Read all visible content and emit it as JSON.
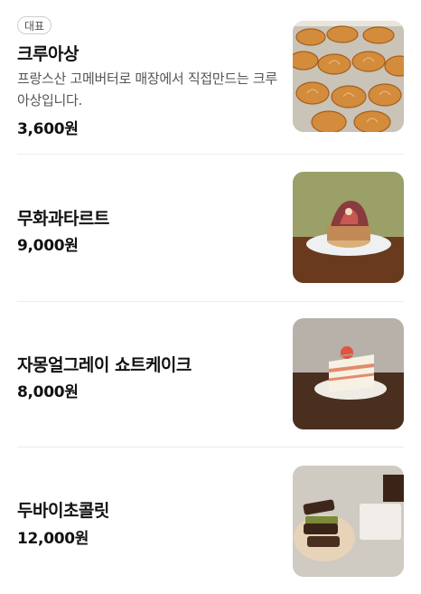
{
  "menu": {
    "items": [
      {
        "badge": "대표",
        "name": "크루아상",
        "description": "프랑스산 고메버터로 매장에서 직접만드는 크루아상입니다.",
        "price": "3,600원",
        "image": "croissant-tray-photo"
      },
      {
        "name": "무화과타르트",
        "price": "9,000원",
        "image": "fig-tart-photo"
      },
      {
        "name": "자몽얼그레이 쇼트케이크",
        "price": "8,000원",
        "image": "grapefruit-cake-photo"
      },
      {
        "name": "두바이초콜릿",
        "price": "12,000원",
        "image": "dubai-chocolate-photo"
      }
    ]
  }
}
